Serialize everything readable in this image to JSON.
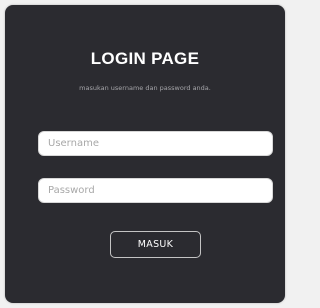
{
  "login": {
    "title": "LOGIN PAGE",
    "subtitle": "masukan username dan password anda.",
    "username_placeholder": "Username",
    "password_placeholder": "Password",
    "submit_label": "MASUK"
  },
  "colors": {
    "card_background": "#2b2b30",
    "page_background": "#f1f1f1",
    "title_text": "#ffffff",
    "subtitle_text": "#a4a4a8",
    "input_background": "#ffffff",
    "button_border": "#c4c4c4"
  }
}
